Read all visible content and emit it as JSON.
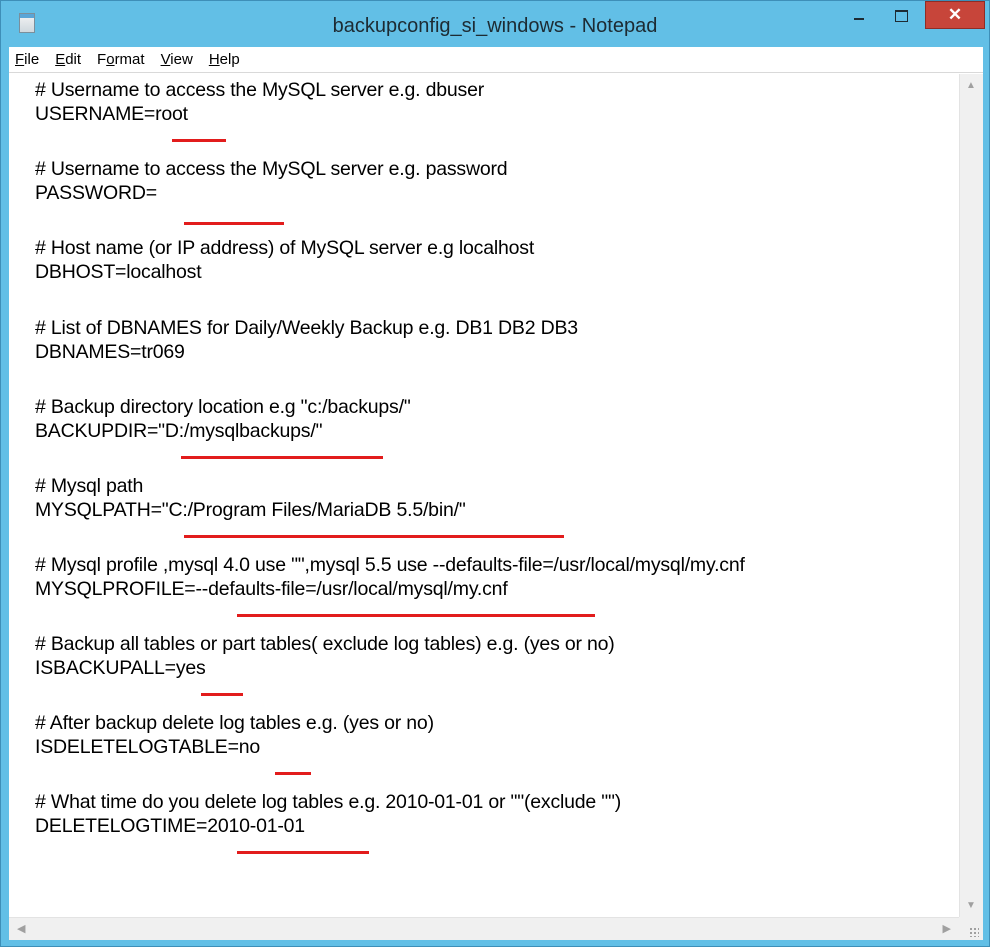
{
  "window": {
    "title": "backupconfig_si_windows - Notepad",
    "close_glyph": "✕"
  },
  "menu": [
    "File",
    "Edit",
    "Format",
    "View",
    "Help"
  ],
  "menu_underlined": [
    "F",
    "E",
    "o",
    "V",
    "H"
  ],
  "lines": [
    {
      "text": "# Username to access the MySQL server e.g. dbuser"
    },
    {
      "text": "USERNAME=root"
    },
    {
      "text": "# Username to access the MySQL server e.g. password"
    },
    {
      "text": "PASSWORD="
    },
    {
      "text": "# Host name (or IP address) of MySQL server e.g localhost"
    },
    {
      "text": "DBHOST=localhost"
    },
    {
      "text": "# List of DBNAMES for Daily/Weekly Backup e.g. DB1 DB2 DB3"
    },
    {
      "text": "DBNAMES=tr069"
    },
    {
      "text": "# Backup directory location e.g \"c:/backups/\""
    },
    {
      "text": "BACKUPDIR=\"D:/mysqlbackups/\""
    },
    {
      "text": "# Mysql path"
    },
    {
      "text": "MYSQLPATH=\"C:/Program Files/MariaDB 5.5/bin/\""
    },
    {
      "text": "# Mysql profile ,mysql 4.0 use \"\",mysql 5.5 use --defaults-file=/usr/local/mysql/my.cnf"
    },
    {
      "text": "MYSQLPROFILE=--defaults-file=/usr/local/mysql/my.cnf"
    },
    {
      "text": "# Backup all tables or part tables( exclude log tables) e.g. (yes or no)"
    },
    {
      "text": "ISBACKUPALL=yes"
    },
    {
      "text": "# After backup delete log tables e.g. (yes or no)"
    },
    {
      "text": "ISDELETELOGTABLE=no"
    },
    {
      "text": "# What time do you delete log tables e.g. 2010-01-01 or \"\"(exclude \"\")"
    },
    {
      "text": "DELETELOGTIME=2010-01-01"
    }
  ],
  "colors": {
    "title_bar": "#62bfe6",
    "close_button": "#c7453a",
    "annotation_underline": "#e21c1c"
  }
}
